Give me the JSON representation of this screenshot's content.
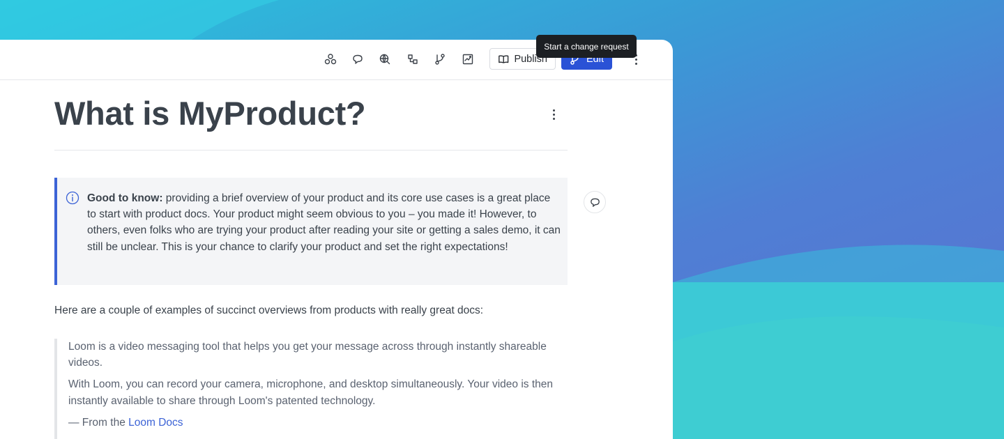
{
  "toolbar": {
    "icons": [
      "bicycle-icon",
      "comment-icon",
      "globe-search-icon",
      "structure-icon",
      "branch-icon",
      "insights-icon"
    ],
    "publish_label": "Publish",
    "edit_label": "Edit",
    "edit_tooltip": "Start a change request",
    "accent_color": "#2a52d6"
  },
  "page": {
    "title": "What is MyProduct?",
    "hint": {
      "lead": "Good to know:",
      "body": "providing a brief overview of your product and its core use cases is a great place to start with product docs. Your product might seem obvious to you – you made it! However, to others, even folks who are trying your product after reading your site or getting a sales demo, it can still be unclear. This is your chance to clarify your product and set the right expectations!"
    },
    "intro": "Here are a couple of examples of succinct overviews from products with really great docs:",
    "quote": {
      "paragraph_1": "Loom is a video messaging tool that helps you get your message across through instantly shareable videos.",
      "paragraph_2": "With Loom, you can record your camera, microphone, and desktop simultaneously. Your video is then instantly available to share through Loom's patented technology.",
      "source_prefix": "— From the",
      "source_link": "Loom Docs"
    }
  }
}
